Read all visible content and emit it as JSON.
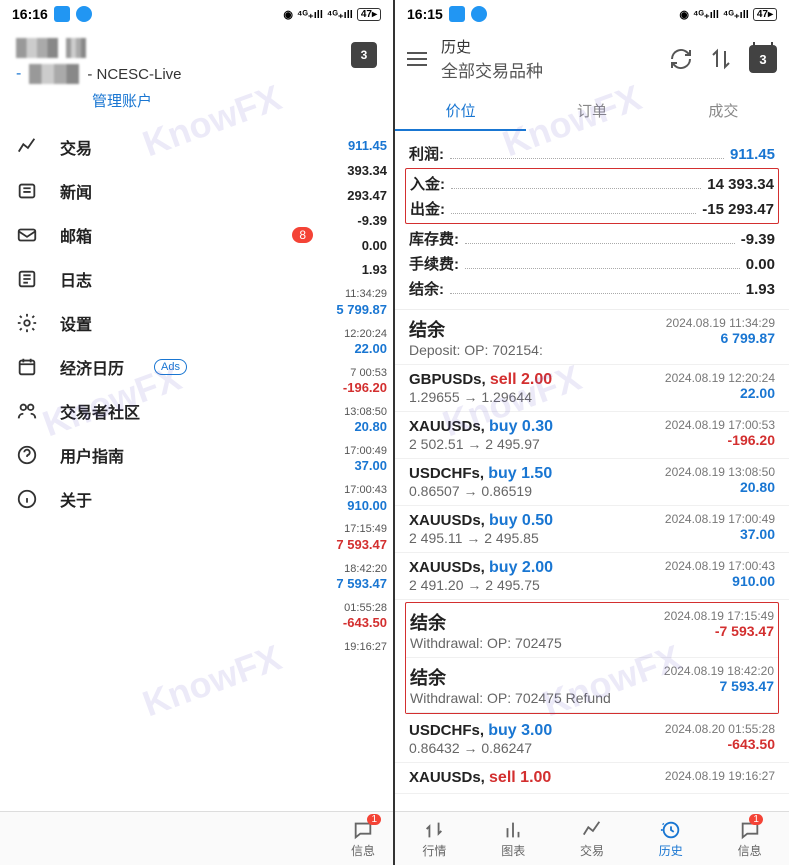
{
  "left": {
    "status_time": "16:16",
    "battery": "47",
    "account_server": "- NCESC-Live",
    "manage": "管理账户",
    "menu": [
      {
        "label": "交易",
        "icon": "trade"
      },
      {
        "label": "新闻",
        "icon": "news"
      },
      {
        "label": "邮箱",
        "icon": "mail",
        "badge": "8"
      },
      {
        "label": "日志",
        "icon": "log"
      },
      {
        "label": "设置",
        "icon": "gear"
      },
      {
        "label": "经济日历",
        "icon": "calendar",
        "ads": "Ads"
      },
      {
        "label": "交易者社区",
        "icon": "community"
      },
      {
        "label": "用户指南",
        "icon": "help"
      },
      {
        "label": "关于",
        "icon": "info"
      }
    ],
    "cal_badge": "3",
    "peek": [
      {
        "t": "",
        "v": "911.45",
        "c": "blue"
      },
      {
        "t": "",
        "v": "393.34",
        "c": "black"
      },
      {
        "t": "",
        "v": "293.47",
        "c": "black"
      },
      {
        "t": "",
        "v": "-9.39",
        "c": "black"
      },
      {
        "t": "",
        "v": "0.00",
        "c": "black"
      },
      {
        "t": "",
        "v": "1.93",
        "c": "black"
      },
      {
        "t": "11:34:29",
        "v": "5 799.87",
        "c": "blue"
      },
      {
        "t": "12:20:24",
        "v": "22.00",
        "c": "blue"
      },
      {
        "t": "7 00:53",
        "v": "-196.20",
        "c": "red"
      },
      {
        "t": "13:08:50",
        "v": "20.80",
        "c": "blue"
      },
      {
        "t": "17:00:49",
        "v": "37.00",
        "c": "blue"
      },
      {
        "t": "17:00:43",
        "v": "910.00",
        "c": "blue"
      },
      {
        "t": "17:15:49",
        "v": "7 593.47",
        "c": "red"
      },
      {
        "t": "18:42:20",
        "v": "7 593.47",
        "c": "blue"
      },
      {
        "t": "01:55:28",
        "v": "-643.50",
        "c": "red"
      },
      {
        "t": "19:16:27",
        "v": "",
        "c": ""
      }
    ]
  },
  "right": {
    "status_time": "16:15",
    "battery": "47",
    "header_title": "历史",
    "header_sub": "全部交易品种",
    "cal_badge": "3",
    "tabs": [
      "价位",
      "订单",
      "成交"
    ],
    "active_tab": 0,
    "summary": [
      {
        "label": "利润:",
        "value": "911.45",
        "c": "blue"
      },
      {
        "label": "入金:",
        "value": "14 393.34",
        "c": "black",
        "hl": true
      },
      {
        "label": "出金:",
        "value": "-15 293.47",
        "c": "black",
        "hl": true
      },
      {
        "label": "库存费:",
        "value": "-9.39",
        "c": "black"
      },
      {
        "label": "手续费:",
        "value": "0.00",
        "c": "black"
      },
      {
        "label": "结余:",
        "value": "1.93",
        "c": "black"
      }
    ],
    "transactions": [
      {
        "sym": "结余",
        "big": true,
        "detail": "Deposit: OP: 702154:",
        "time": "2024.08.19 11:34:29",
        "val": "6 799.87",
        "c": "blue"
      },
      {
        "sym": "GBPUSDs, ",
        "action": "sell 2.00",
        "ac": "red",
        "detail": "1.29655 → 1.29644",
        "time": "2024.08.19 12:20:24",
        "val": "22.00",
        "c": "blue"
      },
      {
        "sym": "XAUUSDs, ",
        "action": "buy 0.30",
        "ac": "blue",
        "detail": "2 502.51 → 2 495.97",
        "time": "2024.08.19 17:00:53",
        "val": "-196.20",
        "c": "red"
      },
      {
        "sym": "USDCHFs, ",
        "action": "buy 1.50",
        "ac": "blue",
        "detail": "0.86507 → 0.86519",
        "time": "2024.08.19 13:08:50",
        "val": "20.80",
        "c": "blue"
      },
      {
        "sym": "XAUUSDs, ",
        "action": "buy 0.50",
        "ac": "blue",
        "detail": "2 495.11 → 2 495.85",
        "time": "2024.08.19 17:00:49",
        "val": "37.00",
        "c": "blue"
      },
      {
        "sym": "XAUUSDs, ",
        "action": "buy 2.00",
        "ac": "blue",
        "detail": "2 491.20 → 2 495.75",
        "time": "2024.08.19 17:00:43",
        "val": "910.00",
        "c": "blue"
      },
      {
        "sym": "结余",
        "big": true,
        "detail": "Withdrawal:  OP: 702475",
        "time": "2024.08.19 17:15:49",
        "val": "-7 593.47",
        "c": "red",
        "hl": true
      },
      {
        "sym": "结余",
        "big": true,
        "detail": "Withdrawal:  OP: 702475 Refund",
        "time": "2024.08.19 18:42:20",
        "val": "7 593.47",
        "c": "blue",
        "hl": true
      },
      {
        "sym": "USDCHFs, ",
        "action": "buy 3.00",
        "ac": "blue",
        "detail": "0.86432 → 0.86247",
        "time": "2024.08.20 01:55:28",
        "val": "-643.50",
        "c": "red"
      },
      {
        "sym": "XAUUSDs, ",
        "action": "sell 1.00",
        "ac": "red",
        "detail": "",
        "time": "2024.08.19 19:16:27",
        "val": "",
        "c": ""
      }
    ],
    "nav": [
      {
        "label": "行情",
        "icon": "quotes"
      },
      {
        "label": "图表",
        "icon": "chart"
      },
      {
        "label": "交易",
        "icon": "trade2"
      },
      {
        "label": "历史",
        "icon": "history",
        "active": true
      },
      {
        "label": "信息",
        "icon": "message",
        "badge": "1"
      }
    ]
  },
  "left_nav": [
    {
      "label": "信息",
      "badge": "1"
    }
  ],
  "watermark": "KnowFX"
}
